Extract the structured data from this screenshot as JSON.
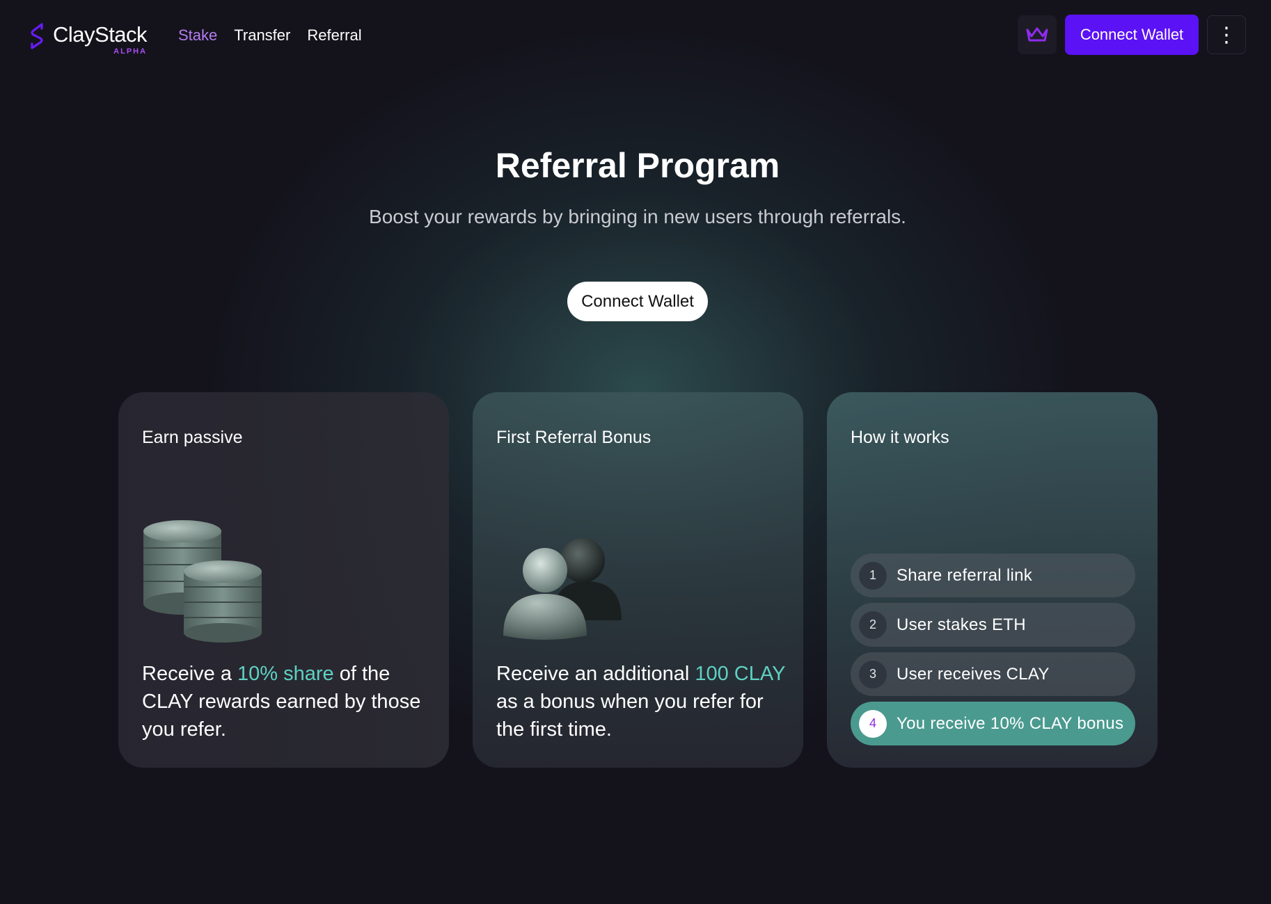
{
  "brand": {
    "name": "ClayStack",
    "tag": "ALPHA"
  },
  "nav": {
    "links": [
      {
        "label": "Stake",
        "active": true
      },
      {
        "label": "Transfer",
        "active": false
      },
      {
        "label": "Referral",
        "active": false
      }
    ],
    "connect_label": "Connect Wallet",
    "menu_glyph": "⋮"
  },
  "hero": {
    "title": "Referral Program",
    "subtitle": "Boost your rewards by bringing in new users through referrals.",
    "button_label": "Connect Wallet"
  },
  "cards": [
    {
      "title": "Earn passive",
      "icon": "coins-icon",
      "text_before": "Receive a ",
      "highlight": "10% share",
      "text_after": " of the CLAY rewards earned by those you refer."
    },
    {
      "title": "First Referral Bonus",
      "icon": "users-icon",
      "text_before": "Receive an additional ",
      "highlight": "100 CLAY",
      "text_after": " as a bonus when you refer for the first time."
    },
    {
      "title": "How it works",
      "steps": [
        {
          "num": "1",
          "label": "Share referral link"
        },
        {
          "num": "2",
          "label": "User stakes ETH"
        },
        {
          "num": "3",
          "label": "User receives CLAY"
        },
        {
          "num": "4",
          "label": "You receive 10% CLAY bonus"
        }
      ]
    }
  ],
  "colors": {
    "accent_purple": "#5b12f4",
    "nav_active": "#b67df0",
    "highlight_teal": "#5fd1c3",
    "active_step": "#4a9a8f"
  }
}
